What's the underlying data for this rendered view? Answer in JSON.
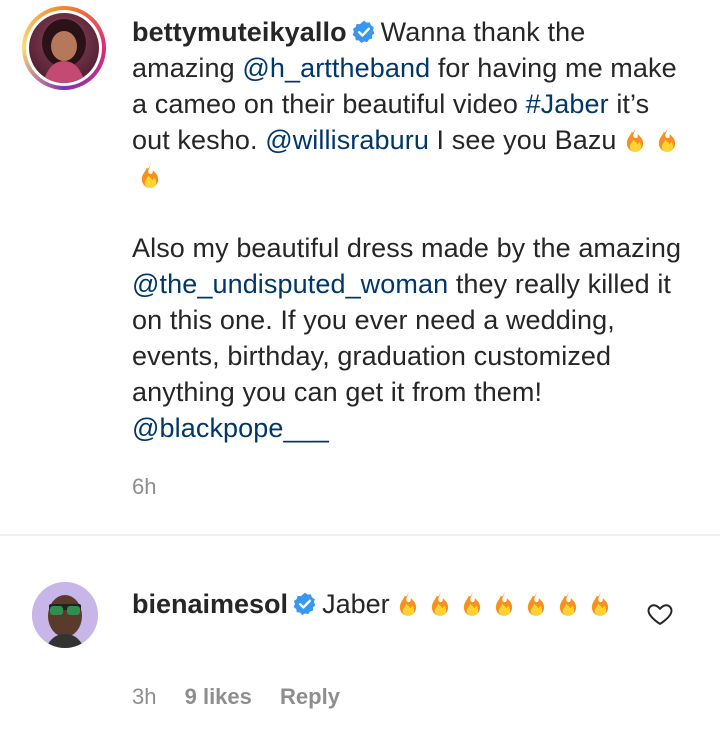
{
  "comment1": {
    "username": "bettymuteikyallo",
    "text_a": "Wanna thank the amazing ",
    "mention_a": "@h_arttheband",
    "text_b": " for having me make a cameo on their beautiful video ",
    "hashtag": "#Jaber",
    "text_c": " it’s out kesho. ",
    "mention_b": "@willisraburu",
    "text_d": " I see you Bazu",
    "fire_count": 3,
    "text_e": "Also my beautiful dress made by the amazing ",
    "mention_c": "@the_undisputed_woman",
    "text_f": " they really killed it on this one. If you ever need a wedding, events, birthday, graduation customized anything you can get it from them! ",
    "mention_d": "@blackpope___",
    "time": "6h"
  },
  "comment2": {
    "username": "bienaimesol",
    "text": "Jaber",
    "fire_count": 7,
    "time": "3h",
    "likes": "9 likes",
    "reply": "Reply"
  },
  "icons": {
    "verified": "verified-badge-icon",
    "fire": "fire-emoji-icon",
    "heart": "heart-outline-icon"
  },
  "colors": {
    "link": "#00376b",
    "verified": "#3897f0",
    "muted": "#8e8e8e"
  }
}
